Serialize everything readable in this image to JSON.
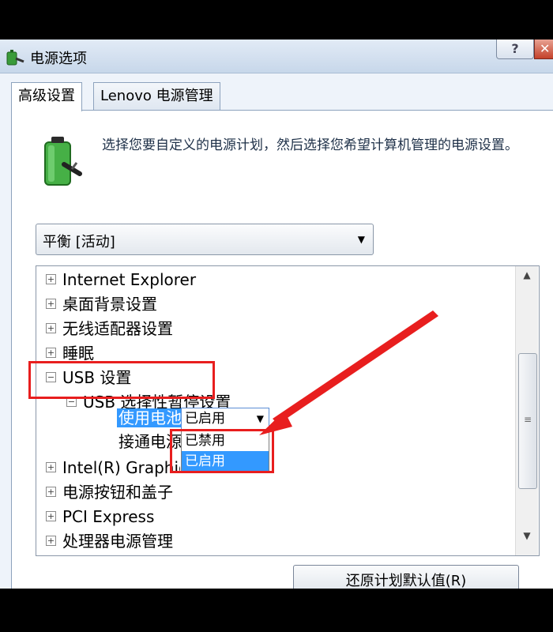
{
  "window": {
    "title": "电源选项",
    "help_label": "?",
    "close_label": "✕"
  },
  "tabs": [
    {
      "label": "高级设置",
      "active": true
    },
    {
      "label": "Lenovo 电源管理",
      "active": false
    }
  ],
  "description": "选择您要自定义的电源计划，然后选择您希望计算机管理的电源设置。",
  "plan_select": {
    "value": "平衡 [活动]"
  },
  "tree": {
    "items": [
      {
        "label": "Internet Explorer",
        "expander": "+"
      },
      {
        "label": "桌面背景设置",
        "expander": "+"
      },
      {
        "label": "无线适配器设置",
        "expander": "+"
      },
      {
        "label": "睡眠",
        "expander": "+"
      },
      {
        "label": "USB 设置",
        "expander": "−"
      },
      {
        "label": "USB 选择性暂停设置",
        "expander": "−"
      },
      {
        "label": "使用电池:"
      },
      {
        "label": "接通电源:"
      },
      {
        "label": "Intel(R) Graphics Settings",
        "expander": "+"
      },
      {
        "label": "电源按钮和盖子",
        "expander": "+"
      },
      {
        "label": "PCI Express",
        "expander": "+"
      },
      {
        "label": "处理器电源管理",
        "expander": "+"
      }
    ],
    "battery_value": "已启用",
    "dropdown_options": [
      {
        "label": "已禁用",
        "selected": false
      },
      {
        "label": "已启用",
        "selected": true
      }
    ]
  },
  "restore_button": "还原计划默认值(R)",
  "colors": {
    "annotation_red": "#e81e1e",
    "selection_blue": "#3399ff"
  }
}
